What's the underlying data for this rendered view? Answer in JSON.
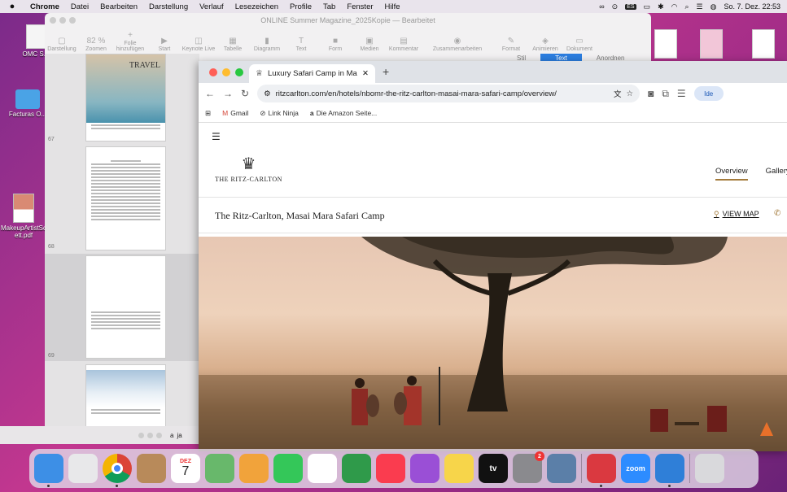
{
  "menubar": {
    "app": "Chrome",
    "items": [
      "Datei",
      "Bearbeiten",
      "Darstellung",
      "Verlauf",
      "Lesezeichen",
      "Profile",
      "Tab",
      "Fenster",
      "Hilfe"
    ],
    "keyboard": "ES",
    "clock": "So. 7. Dez. 22:53"
  },
  "desktop": {
    "icons": [
      {
        "label": "OMC S..."
      },
      {
        "label": "Facturas O..."
      },
      {
        "label": "MakeupArtistSc ett.pdf"
      }
    ]
  },
  "pages_window": {
    "title": "ONLINE Summer Magazine_2025Kopie — Bearbeitet",
    "toolbar": [
      {
        "label": "Darstellung",
        "glyph": "▢"
      },
      {
        "label": "Zoomen",
        "glyph": "82 %"
      },
      {
        "label": "Folie hinzufügen",
        "glyph": "+"
      },
      {
        "label": "Start",
        "glyph": "▶"
      },
      {
        "label": "Keynote Live",
        "glyph": "◫"
      },
      {
        "label": "Tabelle",
        "glyph": "▦"
      },
      {
        "label": "Diagramm",
        "glyph": "▮"
      },
      {
        "label": "Text",
        "glyph": "T"
      },
      {
        "label": "Form",
        "glyph": "■"
      },
      {
        "label": "Medien",
        "glyph": "▣"
      },
      {
        "label": "Kommentar",
        "glyph": "▤"
      },
      {
        "label": "Zusammenarbeiten",
        "glyph": "◉"
      },
      {
        "label": "Format",
        "glyph": "✎"
      },
      {
        "label": "Animieren",
        "glyph": "◈"
      },
      {
        "label": "Dokument",
        "glyph": "▭"
      }
    ],
    "right_tabs": [
      "Stil",
      "Text",
      "Anordnen"
    ],
    "thumb_title": "TRAVEL",
    "page_numbers": [
      "67",
      "68",
      "69"
    ]
  },
  "chrome": {
    "tab_title": "Luxury Safari Camp in Masai Mara",
    "url": "ritzcarlton.com/en/hotels/nbomr-the-ritz-carlton-masai-mara-safari-camp/overview/",
    "profile": "Ide",
    "bookmarks": [
      {
        "label": "Gmail"
      },
      {
        "label": "Link Ninja"
      },
      {
        "label": "Die Amazon Seite..."
      }
    ]
  },
  "site": {
    "brand": "THE RITZ-CARLTON",
    "nav": [
      "Overview",
      "Gallery"
    ],
    "hotel_name": "The Ritz-Carlton, Masai Mara Safari Camp",
    "view_map": "VIEW MAP"
  },
  "minimized": {
    "label": "ja"
  },
  "dock": {
    "calendar_month": "DEZ",
    "calendar_day": "7",
    "settings_badge": "2",
    "zoom_label": "zoom",
    "tv_label": "tv",
    "apps": [
      {
        "name": "finder-icon",
        "color": "#3d8fe6"
      },
      {
        "name": "launchpad-icon",
        "color": "#e8e8ea"
      },
      {
        "name": "chrome-icon",
        "color": "#ffffff"
      },
      {
        "name": "contacts-icon",
        "color": "#b88a5a"
      },
      {
        "name": "calendar-icon",
        "color": "#ffffff"
      },
      {
        "name": "maps-icon",
        "color": "#68b86b"
      },
      {
        "name": "pages-icon",
        "color": "#f1a33b"
      },
      {
        "name": "facetime-icon",
        "color": "#34c759"
      },
      {
        "name": "reminders-icon",
        "color": "#ffffff"
      },
      {
        "name": "numbers-icon",
        "color": "#2f9a4a"
      },
      {
        "name": "music-icon",
        "color": "#fa3c4f"
      },
      {
        "name": "podcasts-icon",
        "color": "#9a4fd6"
      },
      {
        "name": "notes-icon",
        "color": "#f7d54a"
      },
      {
        "name": "tv-icon",
        "color": "#111111"
      },
      {
        "name": "system-settings-icon",
        "color": "#8a8a8e"
      },
      {
        "name": "preview-icon",
        "color": "#5b7fa8"
      },
      {
        "name": "expressvpn-icon",
        "color": "#da3940"
      },
      {
        "name": "zoom-icon",
        "color": "#2d8cff"
      },
      {
        "name": "keynote-icon",
        "color": "#2f7fd8"
      },
      {
        "name": "trash-icon",
        "color": "#d9d9dc"
      }
    ]
  },
  "colors": {
    "accent": "#a37a3b",
    "keynote_selection": "#2c7ee0"
  }
}
